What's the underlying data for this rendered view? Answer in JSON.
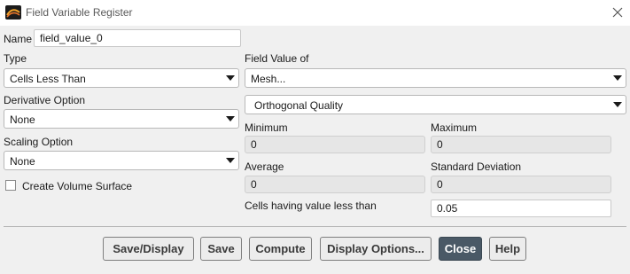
{
  "window": {
    "title": "Field Variable Register"
  },
  "name": {
    "label": "Name",
    "value": "field_value_0"
  },
  "type": {
    "label": "Type",
    "value": "Cells Less Than"
  },
  "derivative_option": {
    "label": "Derivative Option",
    "value": "None"
  },
  "scaling_option": {
    "label": "Scaling Option",
    "value": "None"
  },
  "create_volume_surface": {
    "label": "Create Volume Surface",
    "checked": false
  },
  "field_value_of": {
    "label": "Field Value of",
    "category": "Mesh...",
    "quantity": "Orthogonal Quality"
  },
  "stats": {
    "minimum": {
      "label": "Minimum",
      "value": "0"
    },
    "maximum": {
      "label": "Maximum",
      "value": "0"
    },
    "average": {
      "label": "Average",
      "value": "0"
    },
    "std_dev": {
      "label": "Standard Deviation",
      "value": "0"
    }
  },
  "threshold": {
    "label": "Cells having value less than",
    "value": "0.05"
  },
  "buttons": {
    "save_display": "Save/Display",
    "save": "Save",
    "compute": "Compute",
    "display_options": "Display Options...",
    "close": "Close",
    "help": "Help"
  },
  "colors": {
    "primary_button": "#4a5966",
    "window_bg": "#f0f0f0",
    "readonly_bg": "#e6e6e6"
  },
  "icons": {
    "app": "fluent-app-icon",
    "window_close": "close-icon",
    "dropdown": "caret-down-icon"
  }
}
